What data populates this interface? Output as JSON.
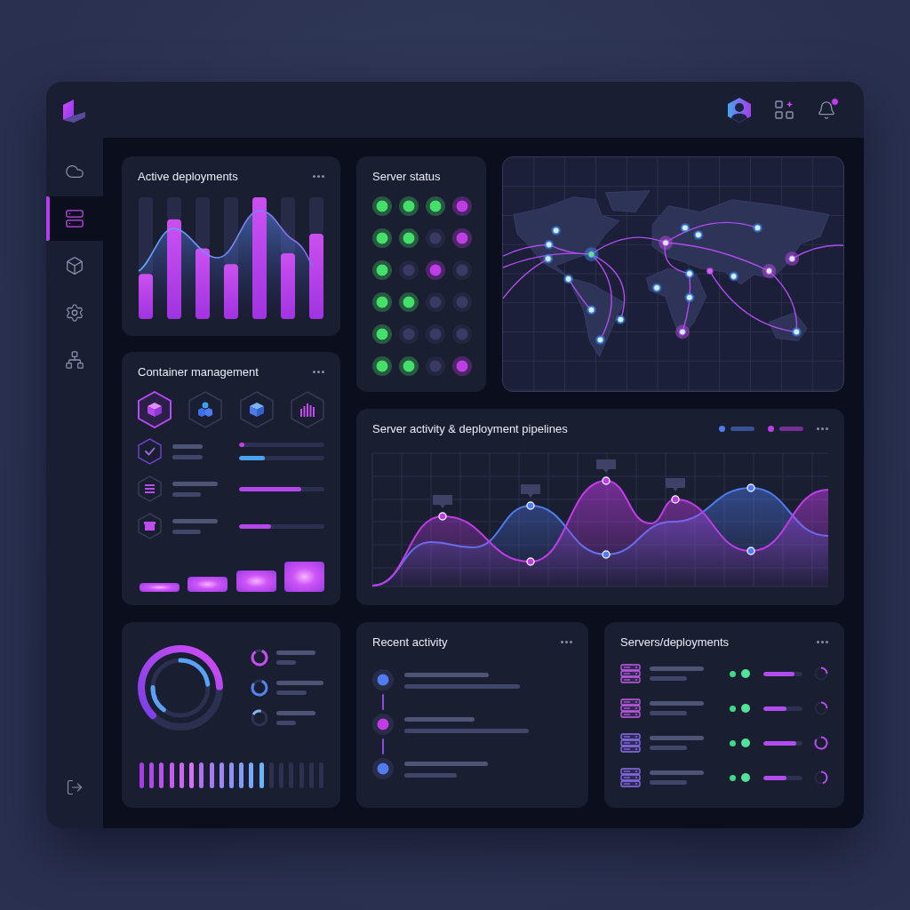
{
  "header": {
    "notifications_unread": true
  },
  "sidebar": {
    "items": [
      {
        "selected": false
      },
      {
        "selected": true
      },
      {
        "selected": false
      },
      {
        "selected": false
      },
      {
        "selected": false
      }
    ]
  },
  "active_deployments": {
    "title": "Active deployments"
  },
  "server_status": {
    "title": "Server status",
    "rows": [
      {
        "dots": [
          {
            "color": "#45e06a"
          },
          {
            "color": "#45e06a"
          },
          {
            "color": "#45e06a"
          },
          {
            "color": "#c03ce6"
          }
        ]
      },
      {
        "dots": [
          {
            "color": "#45e06a"
          },
          {
            "color": "#45e06a"
          },
          {
            "color": "#3b3a63"
          },
          {
            "color": "#c03ce6"
          }
        ]
      },
      {
        "dots": [
          {
            "color": "#45e06a"
          },
          {
            "color": "#3b3a63"
          },
          {
            "color": "#c03ce6"
          },
          {
            "color": "#3b3a63"
          }
        ]
      },
      {
        "dots": [
          {
            "color": "#45e06a"
          },
          {
            "color": "#45e06a"
          },
          {
            "color": "#3b3a63"
          },
          {
            "color": "#3b3a63"
          }
        ]
      },
      {
        "dots": [
          {
            "color": "#45e06a"
          },
          {
            "color": "#3b3a63"
          },
          {
            "color": "#3b3a63"
          },
          {
            "color": "#3b3a63"
          }
        ]
      },
      {
        "dots": [
          {
            "color": "#45e06a"
          },
          {
            "color": "#45e06a"
          },
          {
            "color": "#3b3a63"
          },
          {
            "color": "#c03ce6"
          }
        ]
      }
    ]
  },
  "container_management": {
    "title": "Container management",
    "tiles": [
      {
        "selected": true
      },
      {
        "selected": false
      },
      {
        "selected": false
      },
      {
        "selected": false
      }
    ],
    "rows": [
      {
        "bars": [
          {
            "level": 0.06,
            "color": "#c33ee8"
          },
          {
            "level": 0.3,
            "color": "#4aa3f0"
          }
        ]
      },
      {
        "bars": [
          {
            "level": 0.73,
            "color": "#b446ec"
          }
        ]
      },
      {
        "bars": [
          {
            "level": 0.38,
            "color": "#b446ec"
          }
        ]
      }
    ]
  },
  "activity_chart": {
    "title": "Server activity & deployment pipelines",
    "legend": [
      {
        "color": "#4f7cf0"
      },
      {
        "color": "#c03ce6"
      }
    ]
  },
  "gauge": {
    "segments": [
      {
        "on": true
      },
      {
        "on": true
      },
      {
        "on": true
      },
      {
        "on": true
      },
      {
        "on": true
      },
      {
        "on": true
      },
      {
        "on": true
      },
      {
        "on": true
      },
      {
        "on": true
      },
      {
        "on": true
      },
      {
        "on": true
      },
      {
        "on": true
      },
      {
        "on": true
      },
      {
        "on": false
      },
      {
        "on": false
      },
      {
        "on": false
      },
      {
        "on": false
      },
      {
        "on": false
      },
      {
        "on": false
      }
    ]
  },
  "recent_activity": {
    "title": "Recent activity",
    "items": [
      {
        "color": "#4f7cf0"
      },
      {
        "color": "#c03ce6"
      },
      {
        "color": "#4f7cf0"
      }
    ]
  },
  "servers": {
    "title": "Servers/deployments",
    "rows": [
      {
        "progress": {
          "level": 0.8
        }
      },
      {
        "progress": {
          "level": 0.6
        }
      },
      {
        "progress": {
          "level": 0.85
        }
      },
      {
        "progress": {
          "level": 0.6
        }
      }
    ]
  }
}
